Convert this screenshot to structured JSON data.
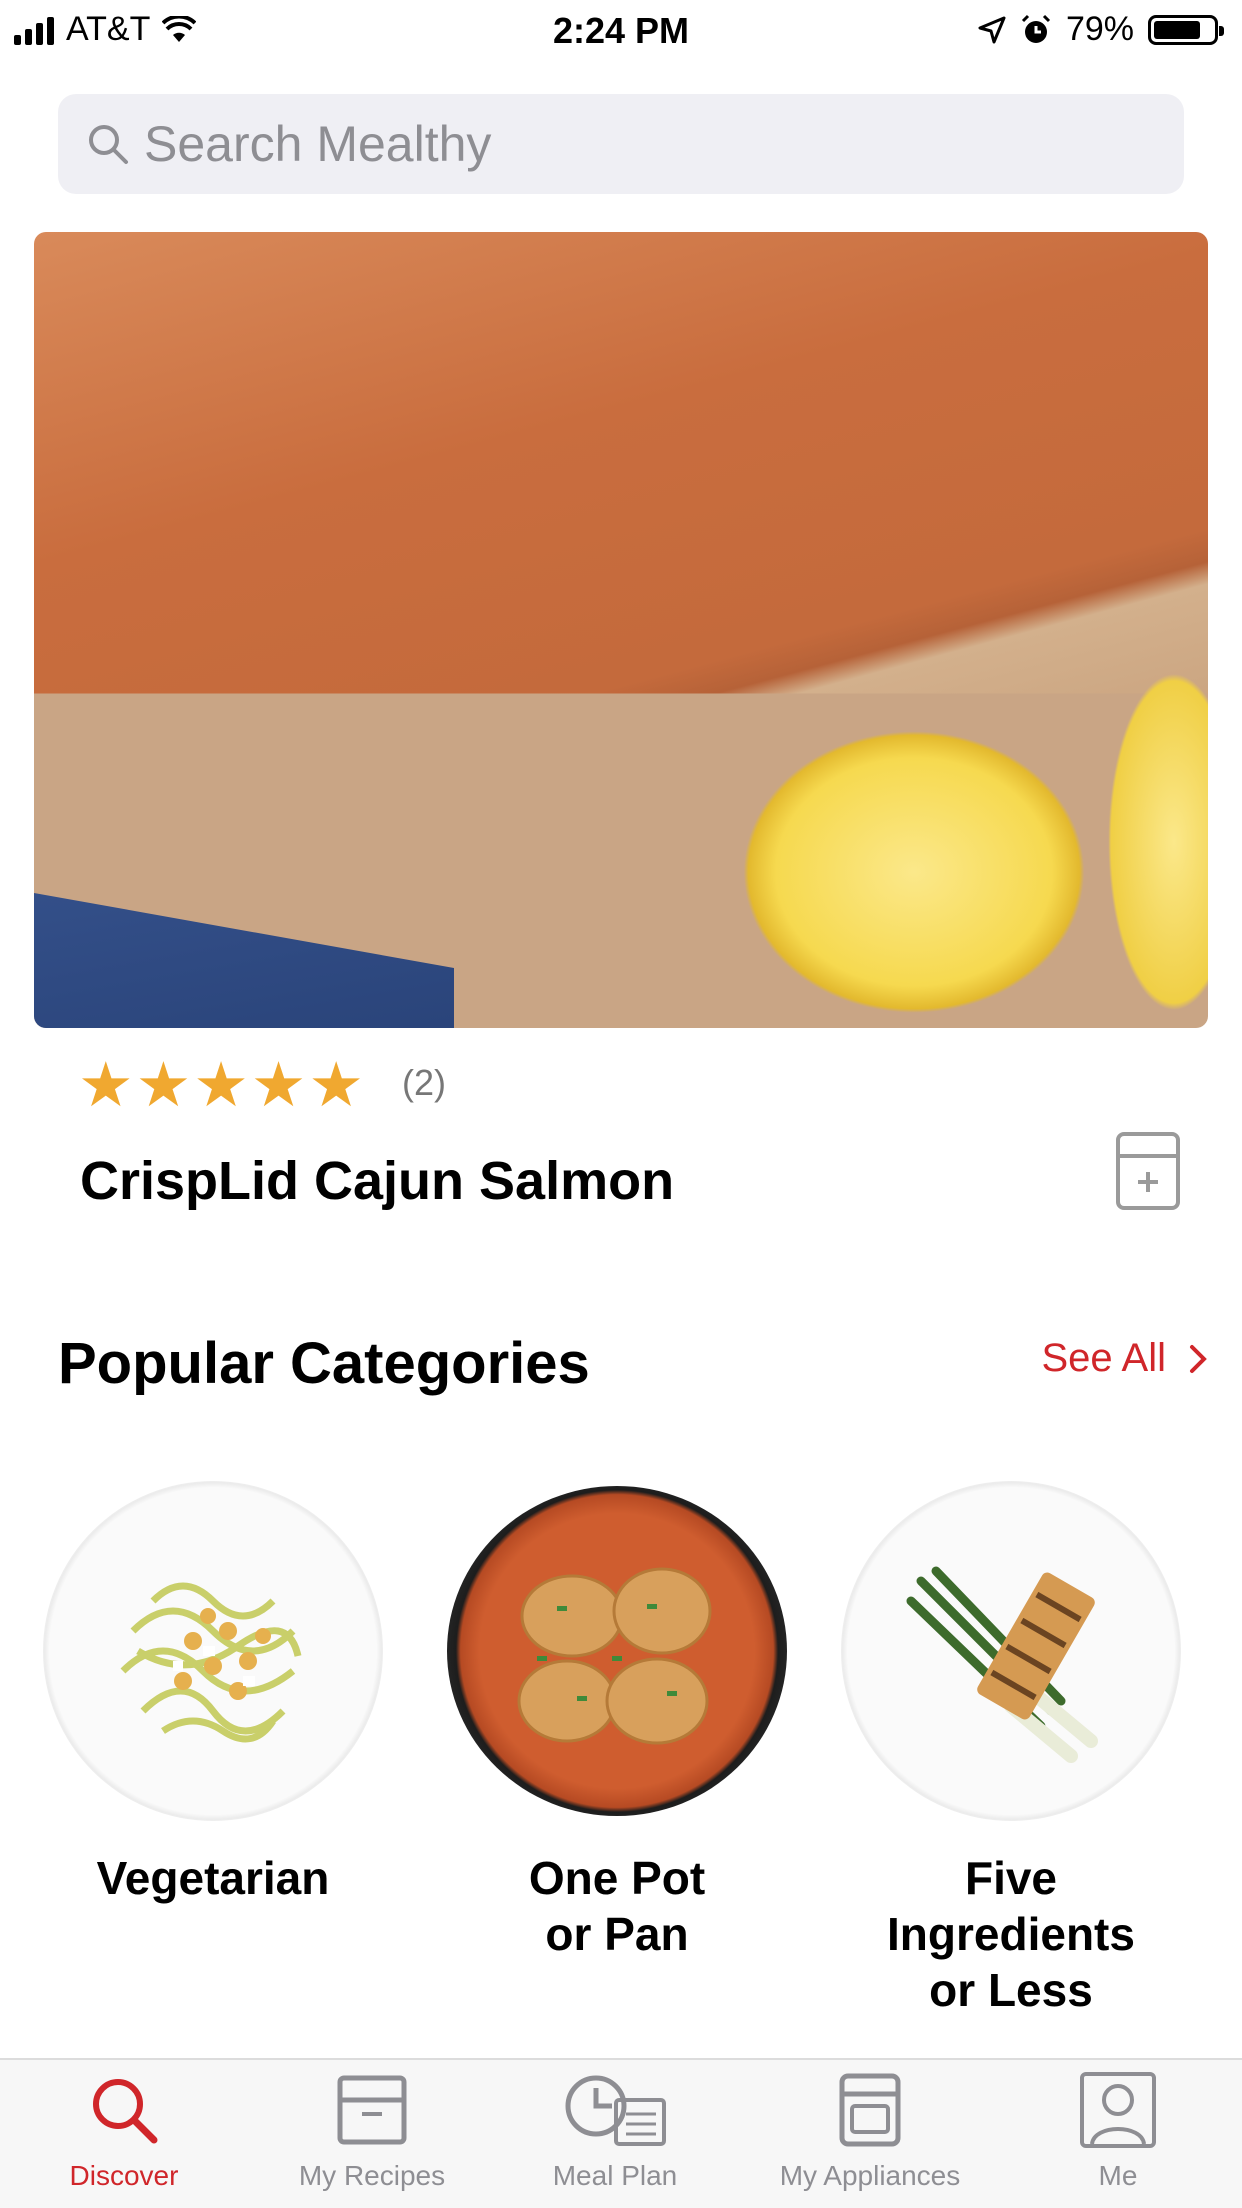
{
  "status_bar": {
    "carrier": "AT&T",
    "time": "2:24 PM",
    "battery": "79%",
    "battery_level": 0.79,
    "icons": [
      "signal-icon",
      "wifi-icon",
      "location-icon",
      "alarm-icon",
      "battery-icon"
    ]
  },
  "search": {
    "placeholder": "Search Mealthy",
    "icon": "search-icon"
  },
  "featured": {
    "rating_stars": 5,
    "rating_count": "(2)",
    "title": "CrispLid Cajun Salmon",
    "save_icon": "add-to-recipe-box-icon"
  },
  "popular": {
    "title": "Popular Categories",
    "see_all": "See All",
    "categories": [
      {
        "label_lines": [
          "Vegetarian"
        ]
      },
      {
        "label_lines": [
          "One Pot",
          "or Pan"
        ]
      },
      {
        "label_lines": [
          "Five",
          "Ingredients",
          "or Less"
        ]
      }
    ]
  },
  "tabs": [
    {
      "label": "Discover",
      "icon": "search-icon",
      "active": true
    },
    {
      "label": "My Recipes",
      "icon": "recipe-box-icon",
      "active": false
    },
    {
      "label": "Meal Plan",
      "icon": "clock-list-icon",
      "active": false
    },
    {
      "label": "My Appliances",
      "icon": "appliance-icon",
      "active": false
    },
    {
      "label": "Me",
      "icon": "profile-icon",
      "active": false
    }
  ],
  "colors": {
    "accent": "#d0262a",
    "star": "#f0a830",
    "muted": "#8e8e93"
  }
}
